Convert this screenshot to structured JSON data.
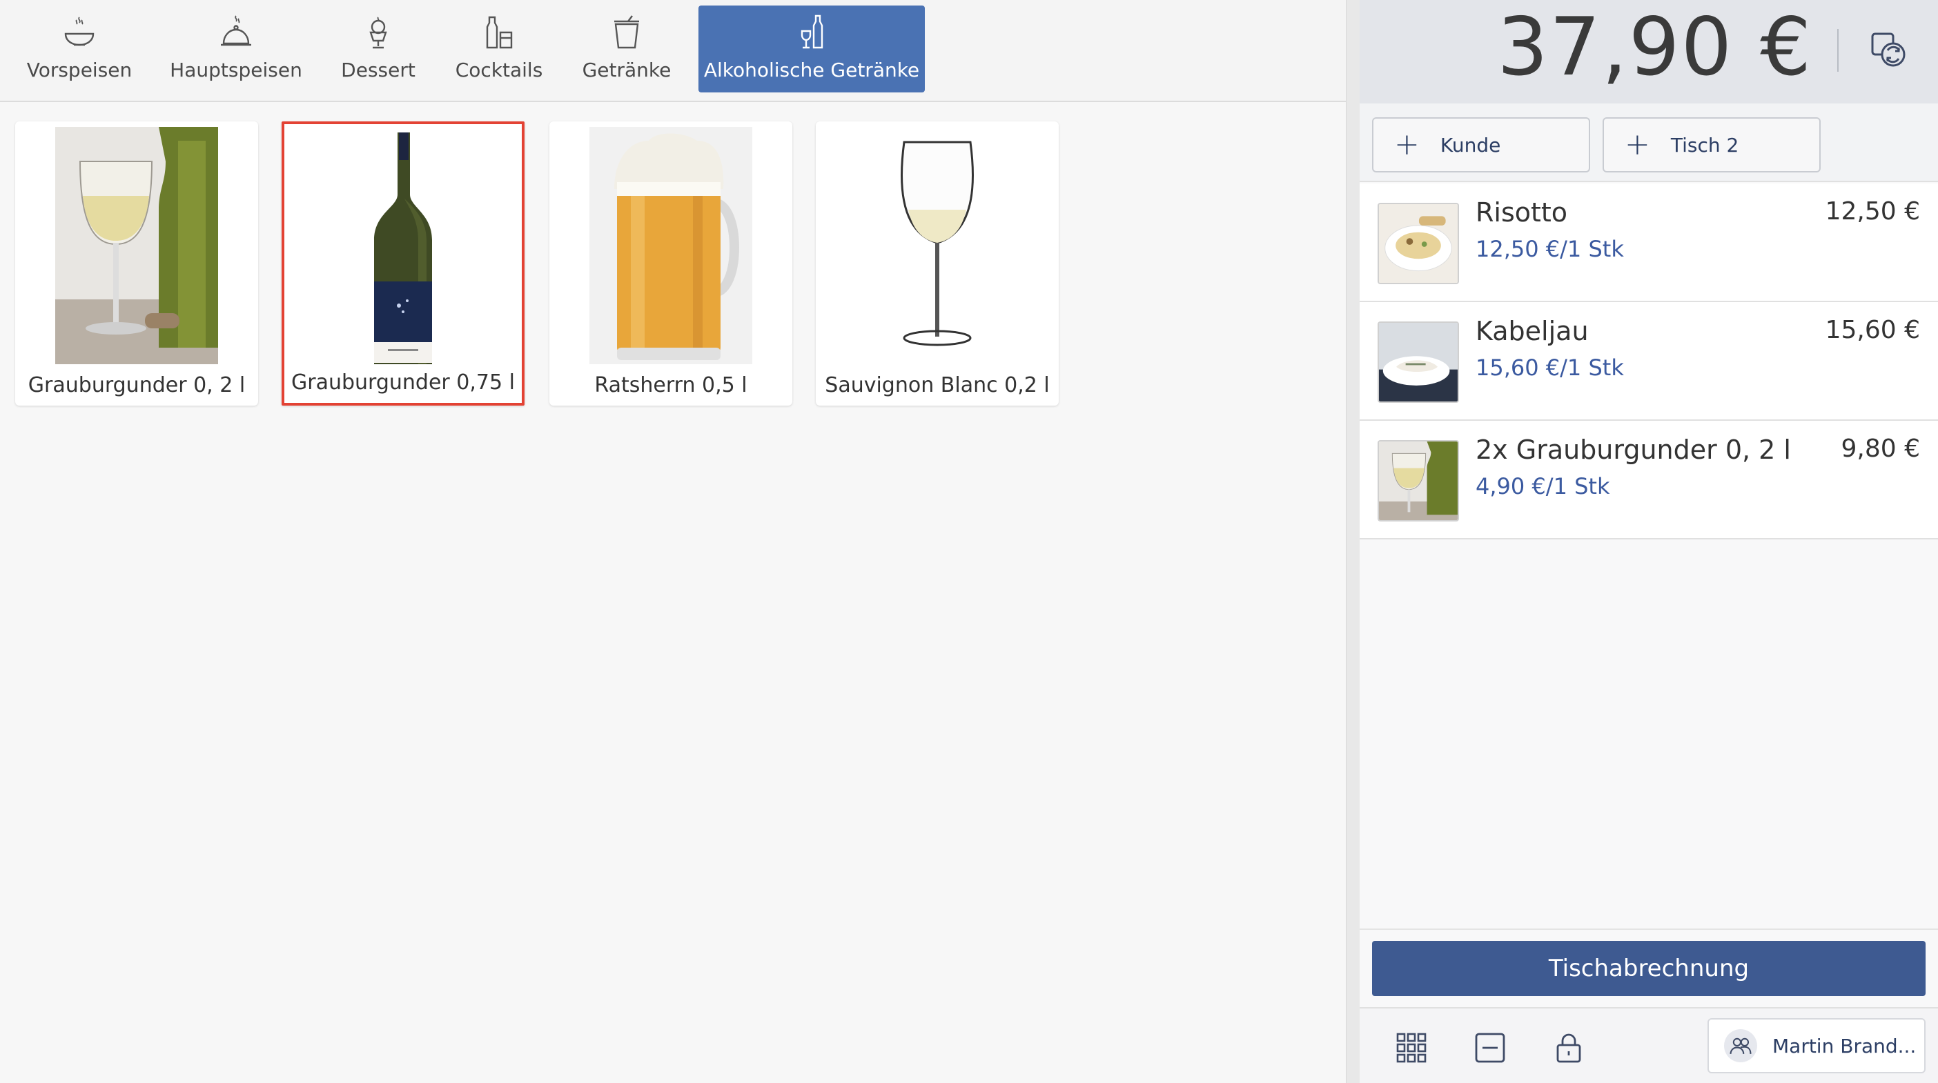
{
  "categories": [
    {
      "label": "Vorspeisen",
      "icon": "soup-bowl-icon",
      "active": false
    },
    {
      "label": "Hauptspeisen",
      "icon": "cloche-icon",
      "active": false
    },
    {
      "label": "Dessert",
      "icon": "ice-cream-icon",
      "active": false
    },
    {
      "label": "Cocktails",
      "icon": "cocktail-icon",
      "active": false
    },
    {
      "label": "Getränke",
      "icon": "cup-icon",
      "active": false
    },
    {
      "label": "Alkoholische Getränke",
      "icon": "wine-bottle-glass-icon",
      "active": true
    }
  ],
  "products": [
    {
      "label": "Grauburgunder 0, 2 l",
      "image": "white-wine-glass-and-bottle",
      "selected": false
    },
    {
      "label": "Grauburgunder 0,75 l",
      "image": "wine-bottle",
      "selected": true
    },
    {
      "label": "Ratsherrn 0,5 l",
      "image": "beer-mug",
      "selected": false
    },
    {
      "label": "Sauvignon Blanc 0,2 l",
      "image": "wine-glass",
      "selected": false
    }
  ],
  "total": "37,90 €",
  "chips": {
    "customer": "Kunde",
    "table": "Tisch 2"
  },
  "orders": [
    {
      "name": "Risotto",
      "unit": "12,50 €/1 Stk",
      "price": "12,50 €",
      "image": "risotto-plate"
    },
    {
      "name": "Kabeljau",
      "unit": "15,60 €/1 Stk",
      "price": "15,60 €",
      "image": "cod-plate"
    },
    {
      "name": "2x Grauburgunder 0, 2 l",
      "unit": "4,90 €/1 Stk",
      "price": "9,80 €",
      "image": "white-wine-glass-and-bottle"
    }
  ],
  "settle_label": "Tischabrechnung",
  "user_name": "Martin Brand...",
  "colors": {
    "accent": "#4a72b3",
    "primary_button": "#3e5a91",
    "selection": "#e34234",
    "unit_text": "#3b5aa0"
  }
}
